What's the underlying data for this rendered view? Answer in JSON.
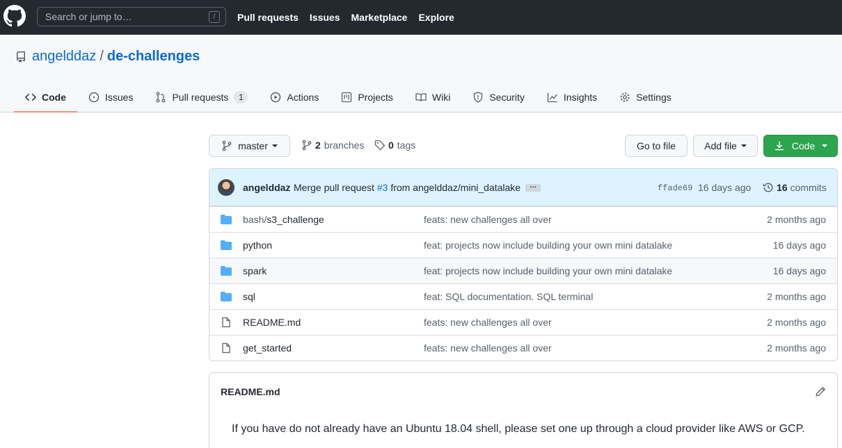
{
  "header": {
    "search_placeholder": "Search or jump to…",
    "search_shortcut": "/",
    "nav": [
      "Pull requests",
      "Issues",
      "Marketplace",
      "Explore"
    ]
  },
  "repo": {
    "owner": "angelddaz",
    "separator": "/",
    "name": "de-challenges"
  },
  "tabs": [
    {
      "label": "Code",
      "icon": "code-icon",
      "active": true
    },
    {
      "label": "Issues",
      "icon": "issue-icon"
    },
    {
      "label": "Pull requests",
      "icon": "pull-request-icon",
      "count": "1"
    },
    {
      "label": "Actions",
      "icon": "play-icon"
    },
    {
      "label": "Projects",
      "icon": "project-icon"
    },
    {
      "label": "Wiki",
      "icon": "book-icon"
    },
    {
      "label": "Security",
      "icon": "shield-icon"
    },
    {
      "label": "Insights",
      "icon": "graph-icon"
    },
    {
      "label": "Settings",
      "icon": "gear-icon"
    }
  ],
  "toolbar": {
    "branch": "master",
    "branches_count": "2",
    "branches_label": "branches",
    "tags_count": "0",
    "tags_label": "tags",
    "go_to_file": "Go to file",
    "add_file": "Add file",
    "code": "Code"
  },
  "latest_commit": {
    "author": "angelddaz",
    "message_prefix": "Merge pull request",
    "pr_link": "#3",
    "message_suffix": "from angelddaz/mini_datalake",
    "ellipsis": "…",
    "sha": "ffade69",
    "age": "16 days ago",
    "commit_count": "16",
    "commits_label": "commits"
  },
  "files": [
    {
      "type": "folder",
      "dim_prefix": "bash/",
      "name": "s3_challenge",
      "message": "feats: new challenges all over",
      "age": "2 months ago"
    },
    {
      "type": "folder",
      "dim_prefix": "",
      "name": "python",
      "message": "feat: projects now include building your own mini datalake",
      "age": "16 days ago"
    },
    {
      "type": "folder",
      "dim_prefix": "",
      "name": "spark",
      "message": "feat: projects now include building your own mini datalake",
      "age": "16 days ago"
    },
    {
      "type": "folder",
      "dim_prefix": "",
      "name": "sql",
      "message": "feat: SQL documentation. SQL terminal",
      "age": "2 months ago"
    },
    {
      "type": "file",
      "dim_prefix": "",
      "name": "README.md",
      "message": "feats: new challenges all over",
      "age": "2 months ago"
    },
    {
      "type": "file",
      "dim_prefix": "",
      "name": "get_started",
      "message": "feats: new challenges all over",
      "age": "2 months ago"
    }
  ],
  "readme": {
    "title": "README.md",
    "body": "If you have do not already have an Ubuntu 18.04 shell, please set one up through a cloud provider like AWS or GCP."
  },
  "colors": {
    "header_bg": "#24292f",
    "link": "#0969da",
    "accent_tab": "#fd8c73",
    "code_button": "#2da44e",
    "folder": "#54aeff",
    "commit_bg": "#ddf4ff"
  }
}
